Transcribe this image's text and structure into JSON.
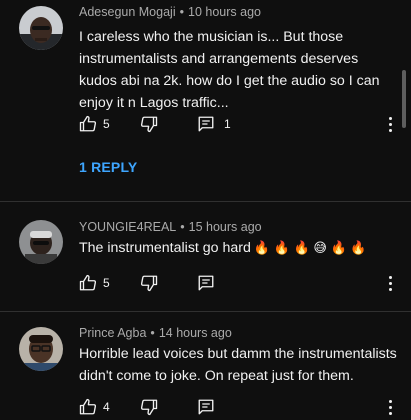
{
  "comments": [
    {
      "author": "Adesegun Mogaji",
      "time": "10 hours ago",
      "text": "I careless who the musician is... But those instrumentalists and arrangements deserves kudos abi na 2k. how do I get the audio so I can enjoy it n Lagos traffic...",
      "likes": "5",
      "replies": "1",
      "reply_link": "1 REPLY"
    },
    {
      "author": "YOUNGIE4REAL",
      "time": "15 hours ago",
      "text": "The instrumentalist go hard",
      "emojis": "🔥 🔥 🔥 😅 🔥 🔥",
      "likes": "5"
    },
    {
      "author": "Prince Agba",
      "time": "14 hours ago",
      "text": "Horrible lead voices but damm the instrumentalists didn't come to joke. On repeat just for them.",
      "likes": "4"
    }
  ],
  "meta_separator": "•",
  "icons": {
    "like": "thumbs-up-icon",
    "dislike": "thumbs-down-icon",
    "reply": "comment-icon",
    "more": "more-vert-icon"
  },
  "colors": {
    "background": "#0f0f0f",
    "text": "#f1f1f1",
    "meta": "#aaaaaa",
    "link": "#3ea6ff",
    "divider": "#303030"
  }
}
